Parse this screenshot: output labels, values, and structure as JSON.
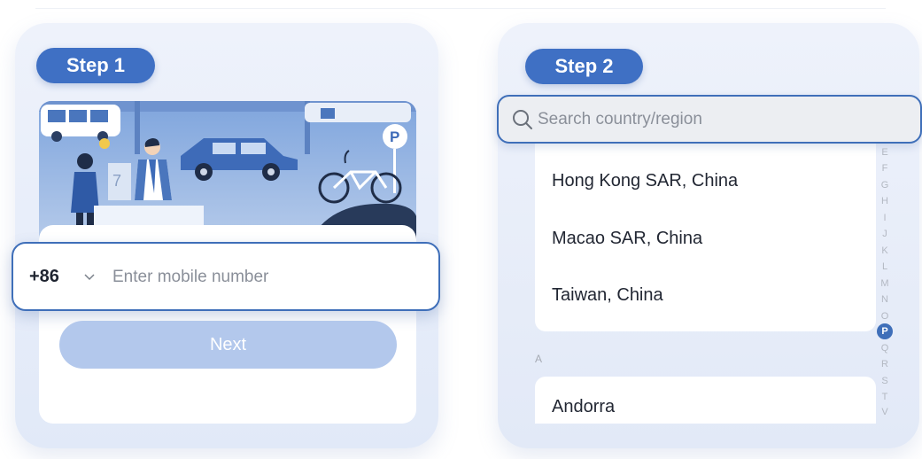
{
  "step1": {
    "badge": "Step 1",
    "phone": {
      "country_code": "+86",
      "placeholder": "Enter mobile number",
      "value": ""
    },
    "next_label": "Next"
  },
  "step2": {
    "badge": "Step 2",
    "search": {
      "placeholder": "Search country/region",
      "value": ""
    },
    "regions": [
      "Hong Kong SAR, China",
      "Macao SAR, China",
      "Taiwan, China"
    ],
    "section_letter": "A",
    "section_items": [
      "Andorra"
    ],
    "alpha_index": [
      "E",
      "F",
      "G",
      "H",
      "I",
      "J",
      "K",
      "L",
      "M",
      "N",
      "O",
      "P",
      "Q",
      "R",
      "S",
      "T",
      "V"
    ],
    "alpha_selected": "P"
  },
  "colors": {
    "accent": "#3f70c4",
    "button_disabled": "#b3c8ec",
    "card_bg": "#e6ecf8"
  }
}
